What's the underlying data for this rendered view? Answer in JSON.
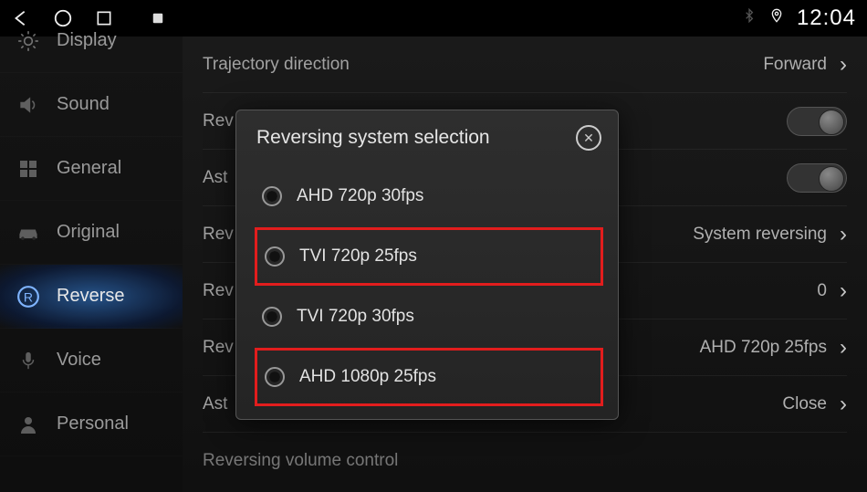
{
  "statusbar": {
    "clock": "12:04"
  },
  "sidebar": {
    "items": [
      {
        "label": "Display"
      },
      {
        "label": "Sound"
      },
      {
        "label": "General"
      },
      {
        "label": "Original"
      },
      {
        "label": "Reverse"
      },
      {
        "label": "Voice"
      },
      {
        "label": "Personal"
      }
    ]
  },
  "settings": {
    "rows": [
      {
        "label": "Trajectory direction",
        "value": "Forward",
        "type": "select"
      },
      {
        "label": "Rev",
        "type": "toggle"
      },
      {
        "label": "Ast",
        "type": "toggle"
      },
      {
        "label": "Rev",
        "value": "System reversing",
        "type": "select"
      },
      {
        "label": "Rev",
        "value": "0",
        "type": "select"
      },
      {
        "label": "Rev",
        "value": "AHD 720p 25fps",
        "type": "select"
      },
      {
        "label": "Ast",
        "value": "Close",
        "type": "select"
      },
      {
        "label": "Reversing volume control",
        "type": "header"
      }
    ]
  },
  "modal": {
    "title": "Reversing system selection",
    "options": [
      {
        "label": "AHD 720p 30fps",
        "highlighted": false
      },
      {
        "label": "TVI 720p 25fps",
        "highlighted": true
      },
      {
        "label": "TVI 720p 30fps",
        "highlighted": false
      },
      {
        "label": "AHD 1080p 25fps",
        "highlighted": true
      }
    ]
  }
}
